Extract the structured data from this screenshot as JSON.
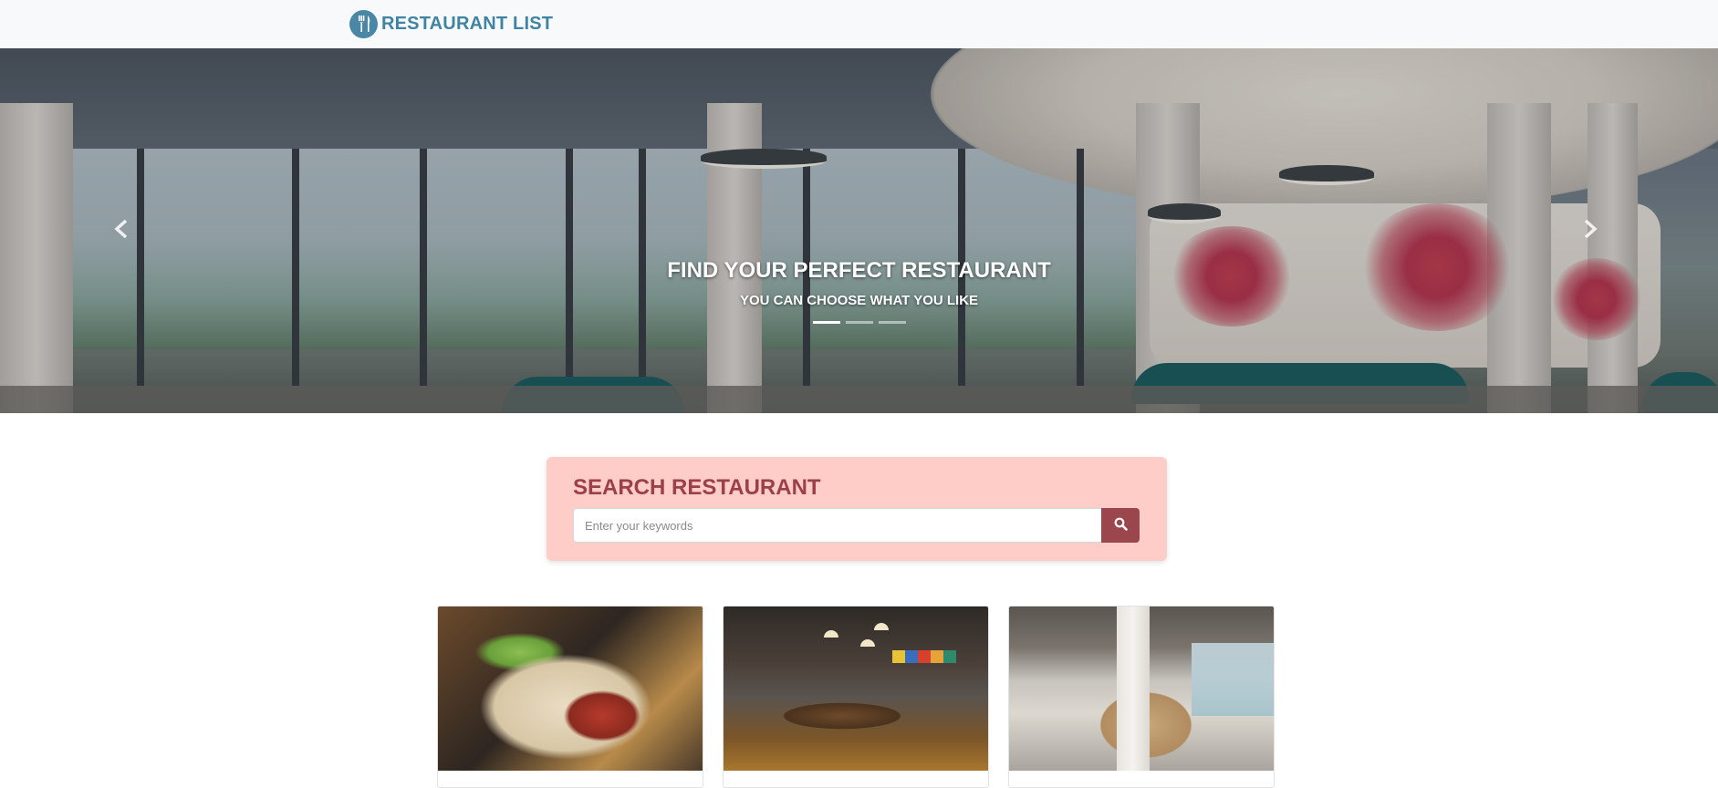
{
  "navbar": {
    "brand_label": "RESTAURANT LIST",
    "brand_icon": "utensils-icon"
  },
  "hero": {
    "title": "FIND YOUR PERFECT RESTAURANT",
    "subtitle": "YOU CAN CHOOSE WHAT YOU LIKE",
    "prev_icon": "chevron-left-icon",
    "next_icon": "chevron-right-icon",
    "slide_count": 3,
    "active_slide": 1
  },
  "search": {
    "title": "SEARCH RESTAURANT",
    "placeholder": "Enter your keywords",
    "value": "",
    "button_icon": "search-icon"
  },
  "cards": [
    {
      "image": "falafel-pita-photo"
    },
    {
      "image": "dining-room-photo"
    },
    {
      "image": "cafe-interior-photo"
    }
  ],
  "colors": {
    "brand": "#3f84a3",
    "search_panel_bg": "#ffcdc7",
    "search_title": "#9b4047",
    "search_button": "#9b454d"
  }
}
